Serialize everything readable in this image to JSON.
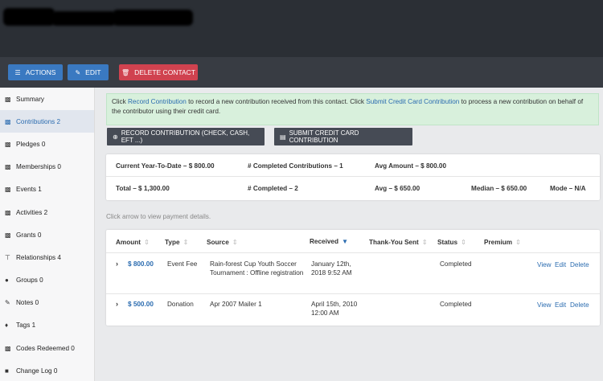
{
  "actions": {
    "actions_label": "ACTIONS",
    "edit_label": "EDIT",
    "delete_label": "DELETE CONTACT"
  },
  "sidebar": {
    "items": [
      {
        "label": "Summary",
        "icon": "chart-icon"
      },
      {
        "label": "Contributions 2",
        "icon": "chart-icon"
      },
      {
        "label": "Pledges 0",
        "icon": "chart-icon"
      },
      {
        "label": "Memberships 0",
        "icon": "chart-icon"
      },
      {
        "label": "Events 1",
        "icon": "chart-icon"
      },
      {
        "label": "Activities 2",
        "icon": "chart-icon"
      },
      {
        "label": "Grants 0",
        "icon": "chart-icon"
      },
      {
        "label": "Relationships 4",
        "icon": "sitemap-icon"
      },
      {
        "label": "Groups 0",
        "icon": "users-icon"
      },
      {
        "label": "Notes 0",
        "icon": "pencil-icon"
      },
      {
        "label": "Tags 1",
        "icon": "tag-icon"
      },
      {
        "label": "Codes Redeemed 0",
        "icon": "chart-icon"
      },
      {
        "label": "Change Log 0",
        "icon": "stop-icon"
      }
    ]
  },
  "notice": {
    "text1": "Click ",
    "link1": "Record Contribution",
    "text2": " to record a new contribution received from this contact. Click ",
    "link2": "Submit Credit Card Contribution",
    "text3": " to process a new contribution on behalf of the contributor using their credit card."
  },
  "buttons": {
    "record": "RECORD CONTRIBUTION (CHECK, CASH, EFT ...)",
    "submit_cc": "SUBMIT CREDIT CARD CONTRIBUTION"
  },
  "summary": {
    "ytd": "Current Year-To-Date – $ 800.00",
    "completed_contributions": "# Completed Contributions – 1",
    "avg_amount": "Avg Amount – $ 800.00",
    "total": "Total – $ 1,300.00",
    "completed": "# Completed – 2",
    "avg": "Avg – $ 650.00",
    "median": "Median – $ 650.00",
    "mode": "Mode – N/A"
  },
  "hint": "Click arrow to view payment details.",
  "table": {
    "headers": {
      "amount": "Amount",
      "type": "Type",
      "source": "Source",
      "received": "Received",
      "thankyou": "Thank-You Sent",
      "status": "Status",
      "premium": "Premium"
    },
    "rows": [
      {
        "amount": "$ 800.00",
        "type": "Event Fee",
        "source": "Rain-forest Cup Youth Soccer Tournament : Offline registration",
        "received": "January 12th, 2018 9:52 AM",
        "status": "Completed",
        "view": "View",
        "edit": "Edit",
        "delete": "Delete"
      },
      {
        "amount": "$ 500.00",
        "type": "Donation",
        "source": "Apr 2007 Mailer 1",
        "received": "April 15th, 2010 12:00 AM",
        "status": "Completed",
        "view": "View",
        "edit": "Edit",
        "delete": "Delete"
      }
    ]
  },
  "colors": {
    "primary": "#3a79c1",
    "danger": "#d0424f",
    "link": "#2b6cb0",
    "notice_bg": "#d8f0dc"
  }
}
